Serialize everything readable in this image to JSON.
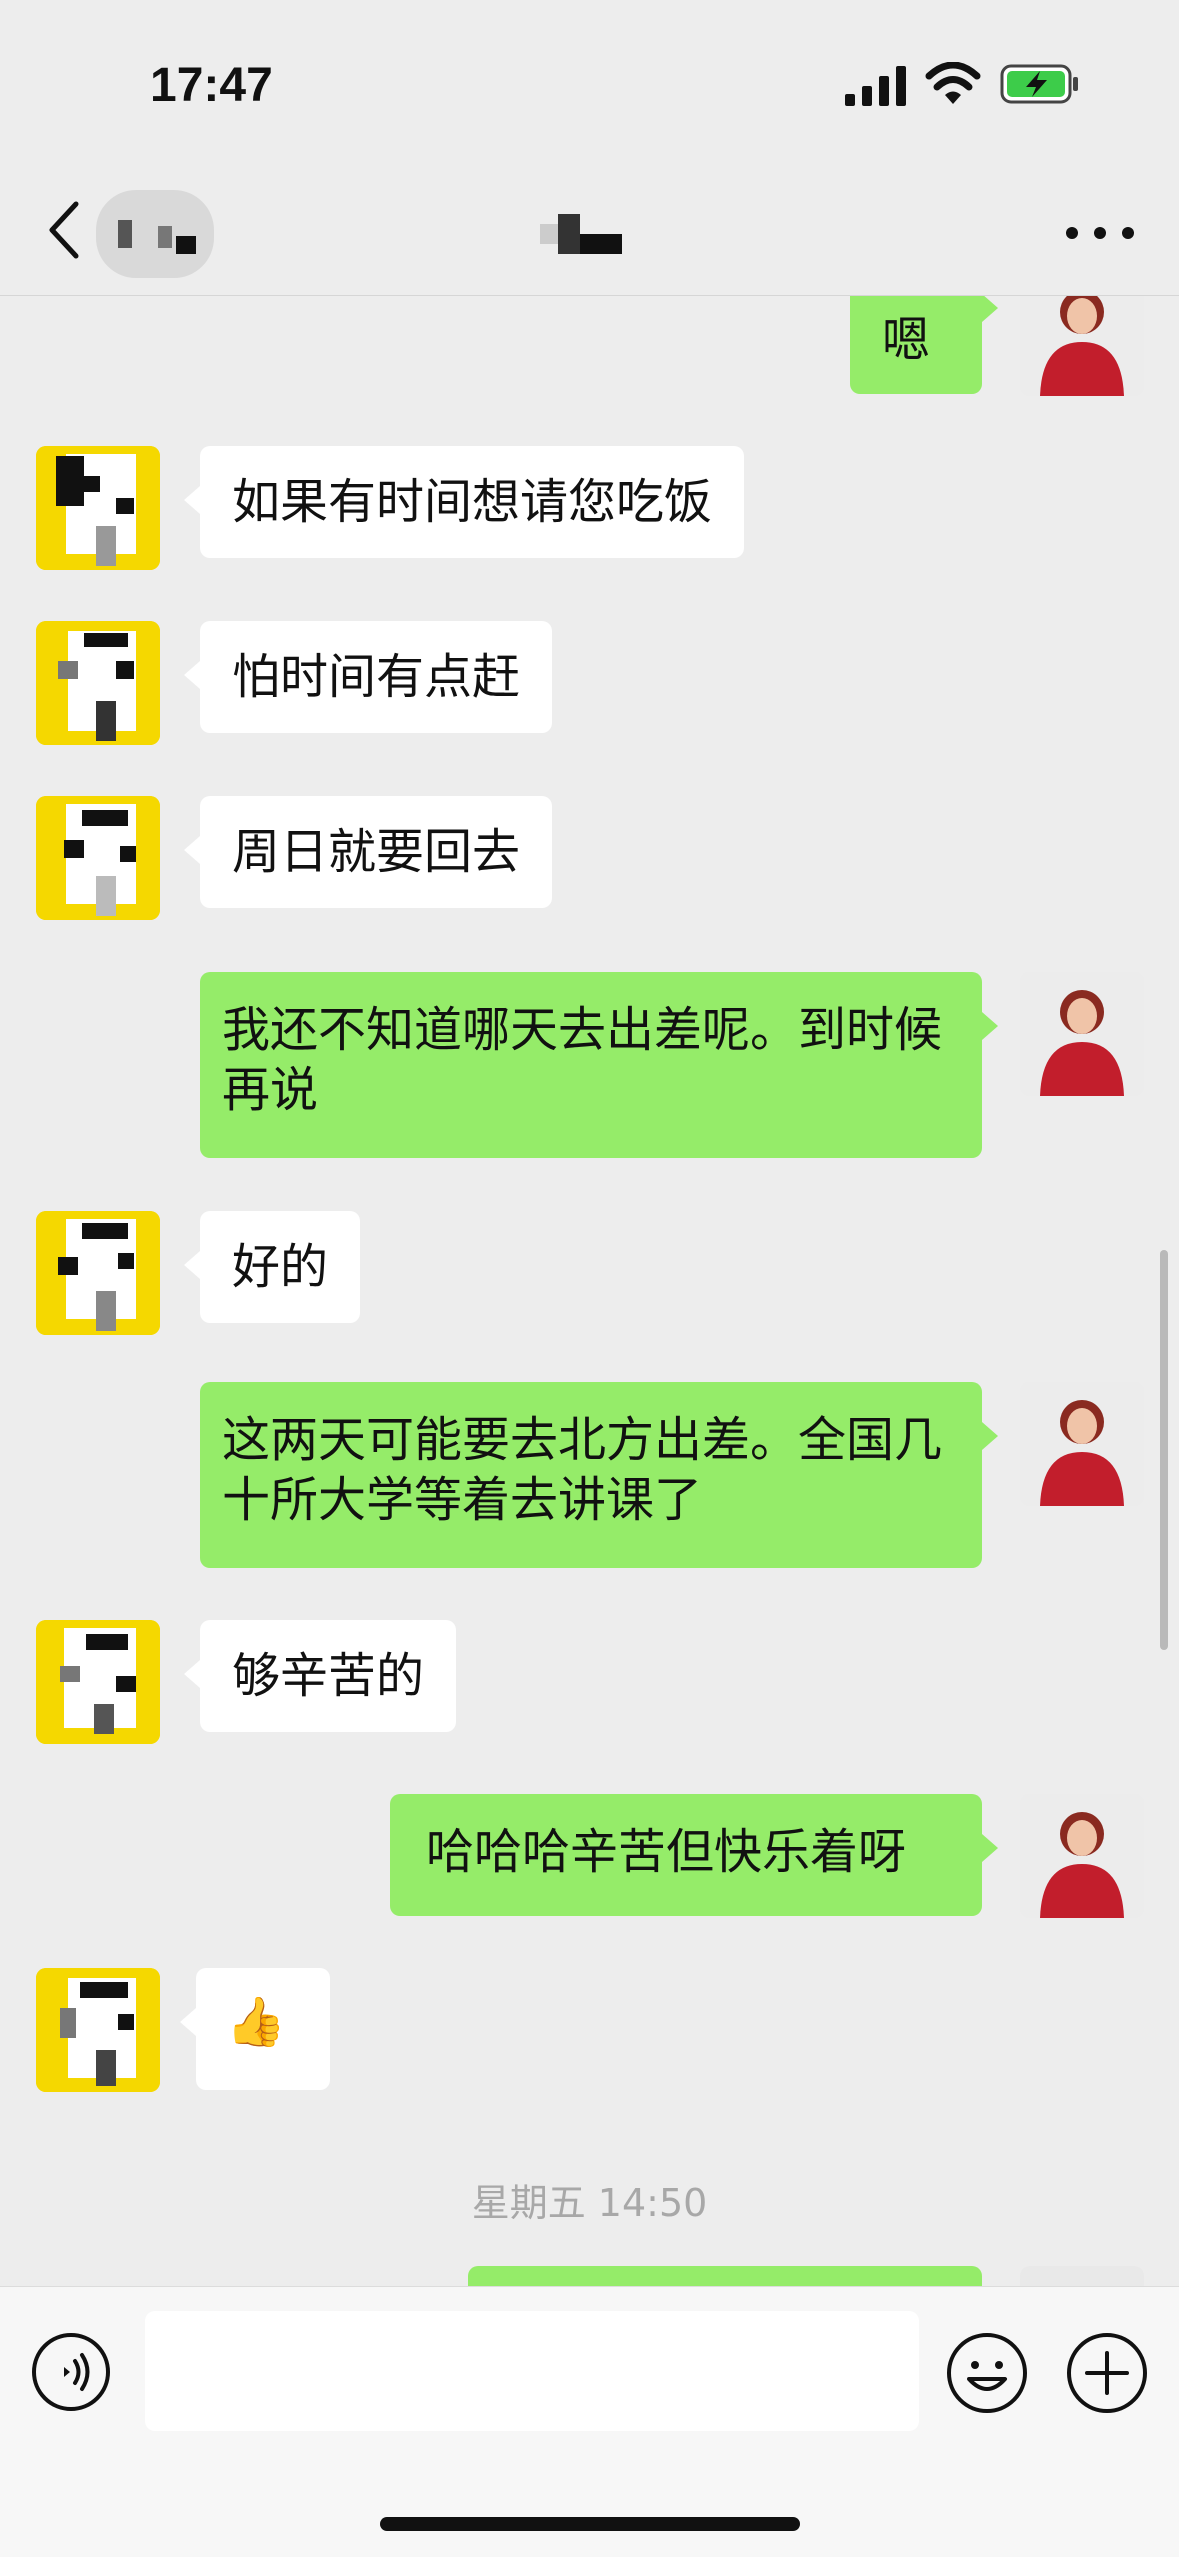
{
  "status_bar": {
    "time": "17:47"
  },
  "messages": [
    {
      "side": "me",
      "text": "嗯"
    },
    {
      "side": "other",
      "text": "如果有时间想请您吃饭"
    },
    {
      "side": "other",
      "text": "怕时间有点赶"
    },
    {
      "side": "other",
      "text": "周日就要回去"
    },
    {
      "side": "me",
      "text": "我还不知道哪天去出差呢。到时候再说"
    },
    {
      "side": "other",
      "text": "好的"
    },
    {
      "side": "me",
      "text": "这两天可能要去北方出差。全国几十所大学等着去讲课了"
    },
    {
      "side": "other",
      "text": "够辛苦的"
    },
    {
      "side": "me",
      "text": "哈哈哈辛苦但快乐着呀"
    },
    {
      "side": "other",
      "text": "👍"
    }
  ],
  "timestamp": "星期五 14:50",
  "icons": {
    "back": "chevron-left-icon",
    "more": "more-icon",
    "voice": "voice-icon",
    "emoji": "emoji-icon",
    "plus": "plus-icon"
  },
  "colors": {
    "background": "#ededed",
    "my_bubble": "#95ec69",
    "their_bubble": "#ffffff"
  }
}
